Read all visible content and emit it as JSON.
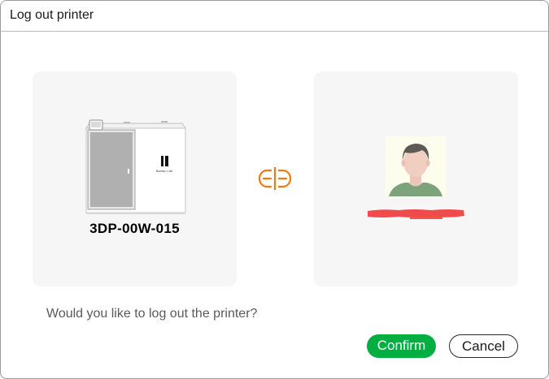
{
  "dialog": {
    "title": "Log out printer",
    "question": "Would you like to log out the printer?",
    "confirm_label": "Confirm",
    "cancel_label": "Cancel"
  },
  "printer": {
    "name": "3DP-00W-015",
    "brand_label": "Bambu Lab"
  },
  "icons": {
    "link": "link-broken-icon",
    "avatar": "user-avatar-icon"
  },
  "colors": {
    "confirm_green": "#00ae42",
    "link_orange": "#f07a12",
    "card_bg": "#f6f6f6",
    "redaction_red": "#f04a4a"
  }
}
